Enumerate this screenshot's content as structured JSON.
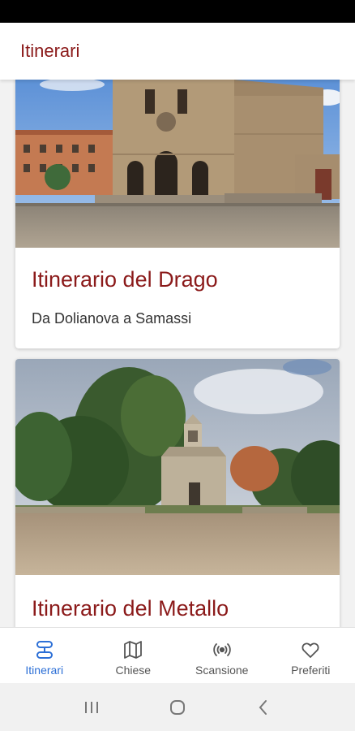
{
  "app": {
    "title": "Itinerari"
  },
  "cards": [
    {
      "title": "Itinerario del Drago",
      "subtitle": "Da Dolianova a Samassi",
      "image": "church-romanesque-facade"
    },
    {
      "title": "Itinerario del Metallo",
      "subtitle": "",
      "image": "stone-chapel-among-trees"
    }
  ],
  "nav": [
    {
      "label": "Itinerari",
      "icon": "route-icon",
      "active": true
    },
    {
      "label": "Chiese",
      "icon": "map-icon",
      "active": false
    },
    {
      "label": "Scansione",
      "icon": "broadcast-icon",
      "active": false
    },
    {
      "label": "Preferiti",
      "icon": "heart-icon",
      "active": false
    }
  ],
  "colors": {
    "accent": "#8b1a1a",
    "nav_active": "#2c6fd6"
  }
}
